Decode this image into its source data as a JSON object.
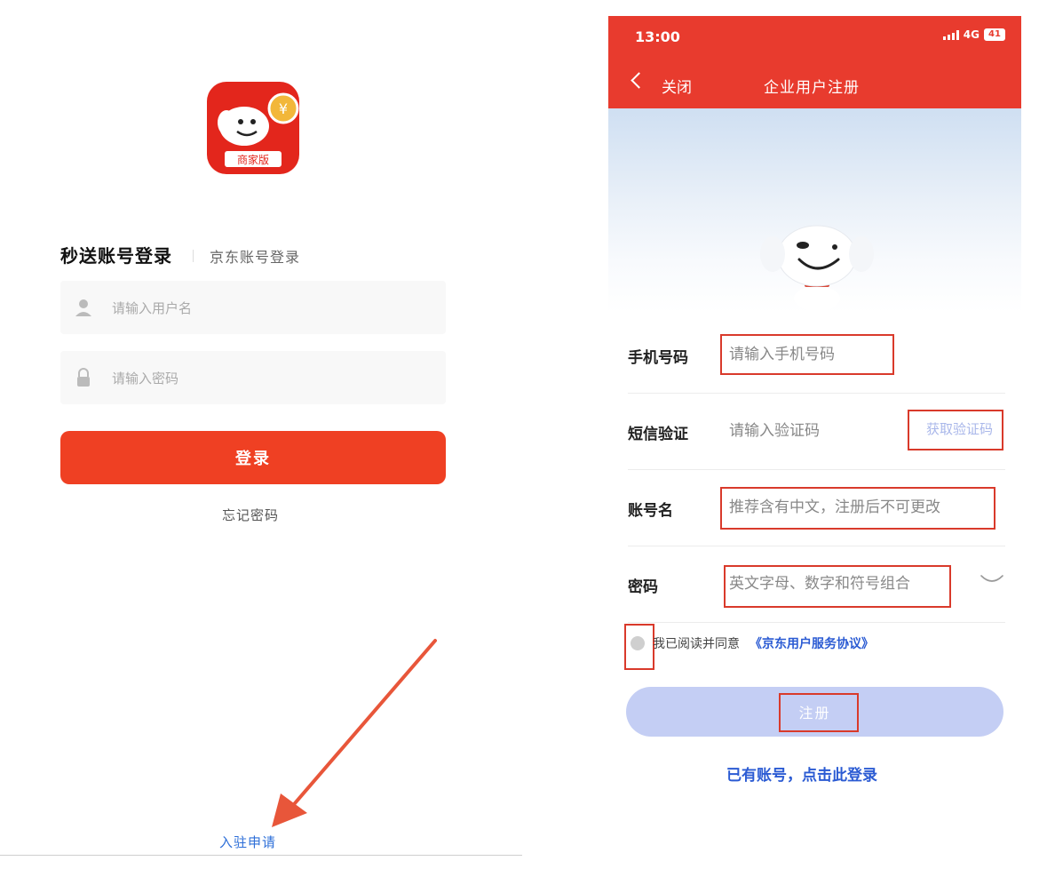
{
  "login_screen": {
    "logo_caption": "商家版",
    "tab_active": "秒送账号登录",
    "tab_inactive": "京东账号登录",
    "username_placeholder": "请输入用户名",
    "password_placeholder": "请输入密码",
    "login_button": "登录",
    "forgot_password": "忘记密码",
    "apply_join": "入驻申请"
  },
  "register_screen": {
    "status_time": "13:00",
    "network": "4G",
    "battery": "41",
    "back_label": "关闭",
    "title": "企业用户注册",
    "phone_label": "手机号码",
    "phone_placeholder": "请输入手机号码",
    "sms_label": "短信验证",
    "sms_placeholder": "请输入验证码",
    "get_code": "获取验证码",
    "account_label": "账号名",
    "account_placeholder": "推荐含有中文，注册后不可更改",
    "password_label": "密码",
    "password_placeholder": "英文字母、数字和符号组合",
    "agree_text": "我已阅读并同意",
    "agree_link": "《京东用户服务协议》",
    "register_button": "注册",
    "login_link": "已有账号，点击此登录"
  },
  "colors": {
    "brand_red": "#e83b2e",
    "login_button": "#ef4023",
    "link_blue": "#2b5bd3",
    "register_button_disabled": "#c4cef4",
    "annotation_box": "#d93a2b"
  }
}
